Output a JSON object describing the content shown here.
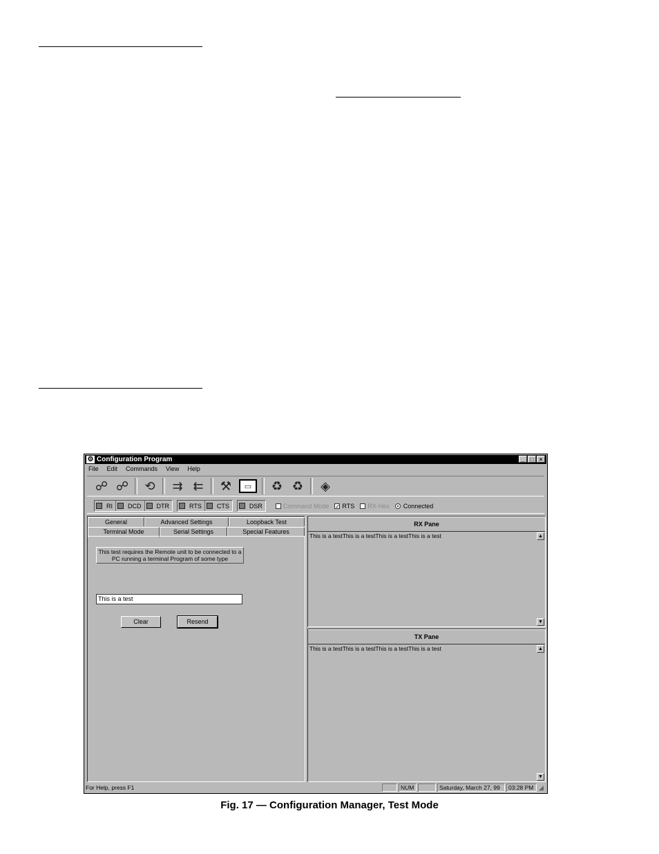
{
  "window": {
    "title": "Configuration Program",
    "icon": "gear-icon",
    "controls": [
      "_",
      "□",
      "×"
    ]
  },
  "menu": [
    "File",
    "Edit",
    "Commands",
    "View",
    "Help"
  ],
  "toolbar": {
    "icons": [
      "connect-icon",
      "disconnect-icon",
      "refresh-icon",
      "send-config-icon",
      "receive-config-icon",
      "tools-icon",
      "terminal-key-icon",
      "recycle-a-icon",
      "recycle-b-icon",
      "book-icon"
    ],
    "glyphs": {
      "connect": "☍",
      "disconnect": "☍",
      "refresh": "⟲",
      "send": "⇉",
      "receive": "⇇",
      "tools": "⚒",
      "terminal": "▭",
      "recycle_a": "♻",
      "recycle_b": "♻",
      "book": "◈"
    }
  },
  "signals": {
    "group1": [
      "RI",
      "DCD",
      "DTR"
    ],
    "group2": [
      "RTS",
      "CTS"
    ],
    "group3": [
      "DSR"
    ],
    "command_mode": "Command Mode",
    "rts": "RTS",
    "rts_check": "✓",
    "rx_hex": "RX-Hex",
    "connected": "Connected"
  },
  "tabs": {
    "row1": [
      "General",
      "Advanced Settings",
      "Loopback Test"
    ],
    "row2": [
      "Terminal Mode",
      "Serial Settings",
      "Special Features"
    ]
  },
  "terminal": {
    "note_line1": "This test requires the Remote unit to be connected to a",
    "note_line2": "PC running a terminal Program of some type",
    "input_value": "This is a test",
    "clear_label": "Clear",
    "resend_label": "Resend"
  },
  "rx_pane": {
    "title": "RX Pane",
    "text": "This is a testThis is a testThis is a testThis is a test"
  },
  "tx_pane": {
    "title": "TX Pane",
    "text": "This is a testThis is a testThis is a testThis is a test"
  },
  "scroll": {
    "up": "▲",
    "down": "▼"
  },
  "statusbar": {
    "help": "For Help, press F1",
    "num": "NUM",
    "date": "Saturday, March 27, 99",
    "time": "03:28 PM",
    "grip": "◢"
  },
  "caption": "Fig. 17 — Configuration Manager, Test Mode"
}
